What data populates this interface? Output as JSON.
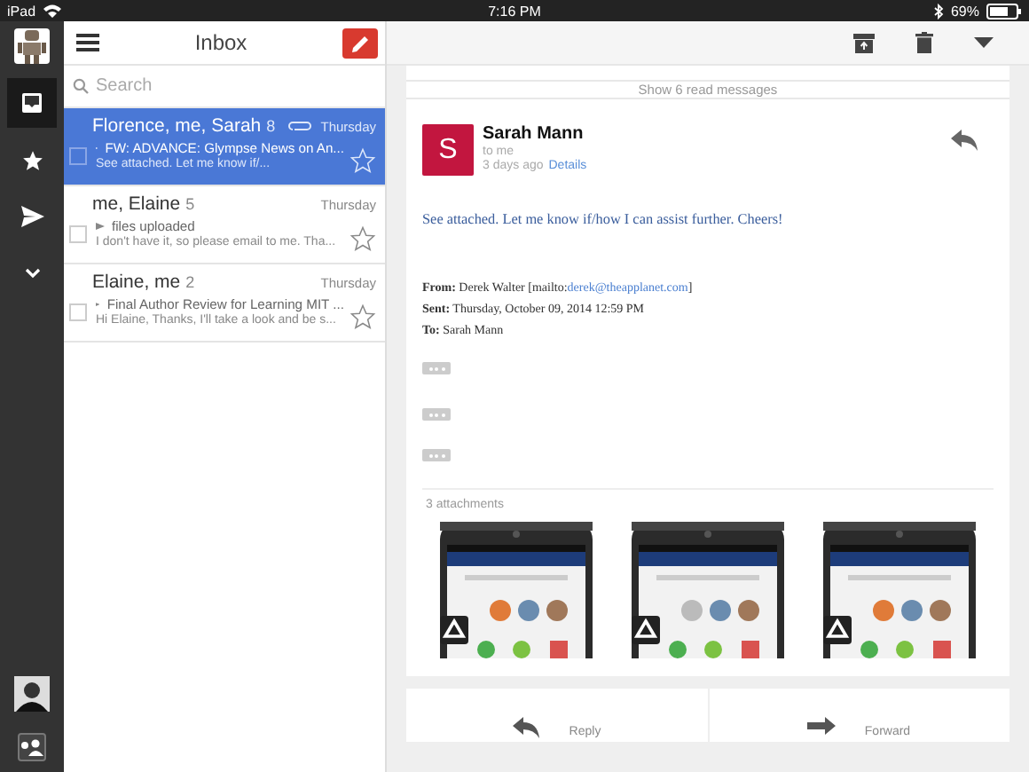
{
  "status_bar": {
    "device": "iPad",
    "time": "7:16 PM",
    "battery": "69%"
  },
  "rail": {
    "items": [
      {
        "kind": "inbox",
        "selected": true
      },
      {
        "kind": "star",
        "selected": false
      },
      {
        "kind": "send",
        "selected": false
      },
      {
        "kind": "chevron",
        "selected": false
      }
    ]
  },
  "list": {
    "title": "Inbox",
    "search": {
      "placeholder": "Search"
    },
    "threads": [
      {
        "senders": "Florence, me, Sarah",
        "count": "8",
        "date": "Thursday",
        "subject": "FW: ADVANCE: Glympse News on An...",
        "snippet": "See attached. Let me know if/...",
        "selected": true,
        "attachment": true,
        "checked": false,
        "starred": false
      },
      {
        "senders": "me, Elaine",
        "count": "5",
        "date": "Thursday",
        "subject": "files uploaded",
        "snippet": "I don't have it, so please email to me. Tha...",
        "selected": false,
        "attachment": false,
        "checked": false,
        "starred": false
      },
      {
        "senders": "Elaine, me",
        "count": "2",
        "date": "Thursday",
        "subject": "Final Author Review for Learning MIT ...",
        "snippet": "Hi Elaine, Thanks, I'll take a look and be s...",
        "selected": false,
        "attachment": false,
        "checked": false,
        "starred": false
      }
    ]
  },
  "message": {
    "show_read": "Show 6 read messages",
    "avatar_letter": "S",
    "sender": "Sarah Mann",
    "to": "to me",
    "time": "3 days ago",
    "details": "Details",
    "body": "See attached. Let me know if/how I can assist further. Cheers!",
    "header_lines": [
      {
        "text": "**From:** Derek Walter [mailto:",
        "link": "derek@theapplanet.com",
        "after": "]"
      },
      {
        "text": "**Sent:** Thursday, October 09, 2014 12:59 PM"
      },
      {
        "text": "**To:** Sarah Mann"
      }
    ],
    "quoted_sections": [
      {
        "expanded": false
      },
      {
        "expanded": false
      },
      {
        "expanded": false
      }
    ],
    "attachments": {
      "label": "3 attachments"
    }
  },
  "actions": [
    "Reply",
    "Forward"
  ]
}
